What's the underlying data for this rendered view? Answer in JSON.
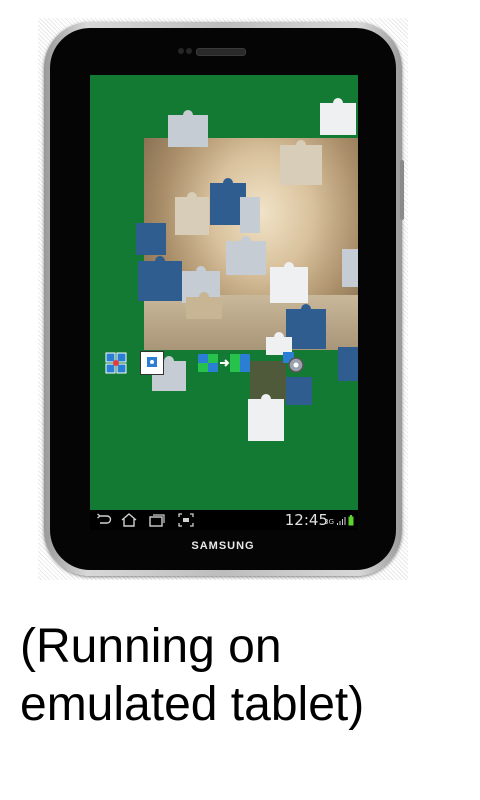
{
  "device": {
    "brand": "SAMSUNG"
  },
  "status_bar": {
    "time": "12:45",
    "network": "3G"
  },
  "toolbar": {
    "buttons": [
      {
        "icon": "shuffle-pieces-icon"
      },
      {
        "icon": "preview-image-icon"
      },
      {
        "icon": "arrange-pieces-icon"
      },
      {
        "icon": "settings-gear-icon"
      }
    ]
  },
  "nav_bar": {
    "icons": [
      "back-icon",
      "home-icon",
      "recent-apps-icon",
      "screenshot-icon"
    ]
  },
  "caption": {
    "line1": "(Running on",
    "line2": "emulated tablet)"
  },
  "colors": {
    "board": "#127a32",
    "bezel": "#050505"
  }
}
